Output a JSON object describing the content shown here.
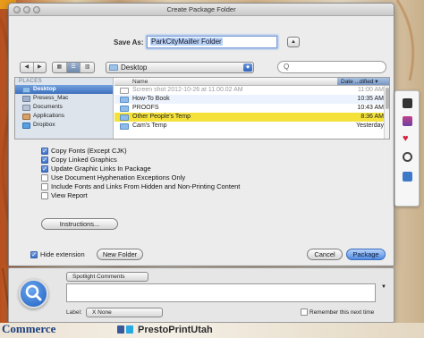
{
  "dialog": {
    "title": "Create Package Folder",
    "save_as_label": "Save As:",
    "save_as_value": "ParkCityMailler Folder",
    "location": "Desktop",
    "search_value": "Q"
  },
  "sidebar": {
    "section_label": "PLACES",
    "items": [
      {
        "label": "Desktop",
        "icon": "desktop-icon",
        "selected": true
      },
      {
        "label": "Presess_Mac",
        "icon": "home-icon",
        "selected": false
      },
      {
        "label": "Documents",
        "icon": "documents-icon",
        "selected": false
      },
      {
        "label": "Applications",
        "icon": "applications-icon",
        "selected": false
      },
      {
        "label": "Dropbox",
        "icon": "dropbox-icon",
        "selected": false
      }
    ]
  },
  "filelist": {
    "col_name": "Name",
    "col_date": "Date ...dified ▾",
    "rows": [
      {
        "name": "Screen shot 2012-10-26 at 11.00.02 AM",
        "date": "11:00 AM",
        "kind": "file",
        "dim": true
      },
      {
        "name": "How-To Book",
        "date": "10:35 AM",
        "kind": "folder",
        "dim": false
      },
      {
        "name": "PROOFS",
        "date": "10:43 AM",
        "kind": "folder",
        "dim": false
      },
      {
        "name": "Other People's Temp",
        "date": "8:36 AM",
        "kind": "folder",
        "dim": false,
        "selected": true
      },
      {
        "name": "Cam's Temp",
        "date": "Yesterday",
        "kind": "folder",
        "dim": false
      }
    ]
  },
  "options": [
    {
      "label": "Copy Fonts (Except CJK)",
      "checked": true
    },
    {
      "label": "Copy Linked Graphics",
      "checked": true
    },
    {
      "label": "Update Graphic Links In Package",
      "checked": true
    },
    {
      "label": "Use Document Hyphenation Exceptions Only",
      "checked": false
    },
    {
      "label": "Include Fonts and Links From Hidden and Non-Printing Content",
      "checked": false
    },
    {
      "label": "View Report",
      "checked": false
    }
  ],
  "buttons": {
    "instructions": "Instructions...",
    "hide_extension": "Hide extension",
    "new_folder": "New Folder",
    "cancel": "Cancel",
    "package": "Package"
  },
  "comments_panel": {
    "spotlight_label": "Spotlight Comments",
    "label_text": "Label:",
    "label_value": "X None",
    "remember_text": "Remember this next time"
  },
  "background": {
    "commerce_text": "Commerce",
    "presto_text": "PrestoPrintUtah"
  },
  "colors": {
    "selected_row": "#f4e23a",
    "default_button": "#4f8ae0",
    "sidebar_bg": "#dde4ec"
  }
}
